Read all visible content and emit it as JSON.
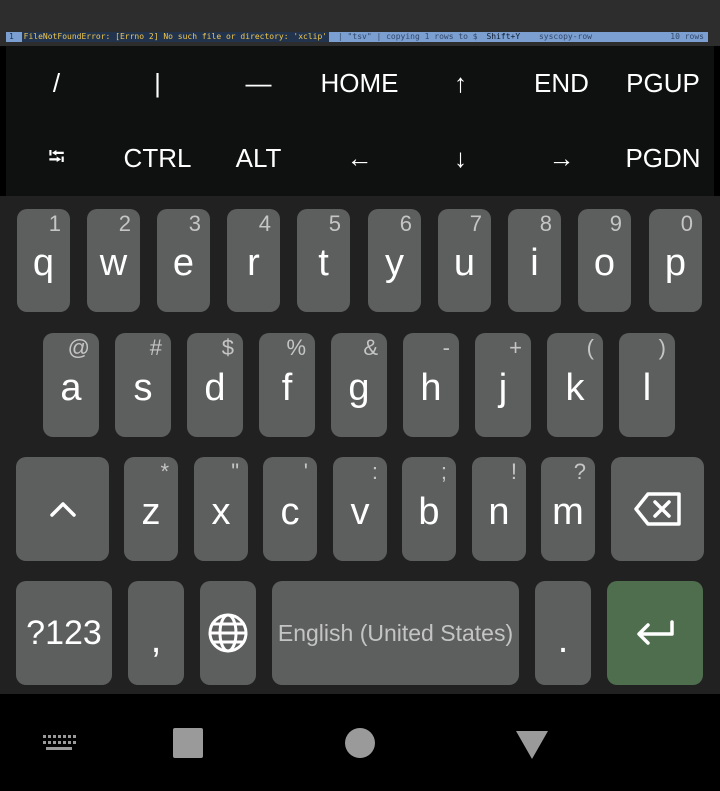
{
  "terminal": {
    "status_left": "1",
    "status_error": "FileNotFoundError: [Errno 2] No such file or directory: 'xclip'",
    "status_hint_pre": "| \"tsv\"  | copying 1 rows to $",
    "status_shortcut": "Shift+Y",
    "status_cmd": "syscopy-row",
    "status_rows": "10 rows"
  },
  "extra_keys": {
    "row1": [
      "/",
      "|",
      "—",
      "HOME",
      "↑",
      "END",
      "PGUP"
    ],
    "row2": [
      "⭾",
      "CTRL",
      "ALT",
      "←",
      "↓",
      "→",
      "PGDN"
    ]
  },
  "keyboard": {
    "row1": [
      {
        "char": "q",
        "hint": "1"
      },
      {
        "char": "w",
        "hint": "2"
      },
      {
        "char": "e",
        "hint": "3"
      },
      {
        "char": "r",
        "hint": "4"
      },
      {
        "char": "t",
        "hint": "5"
      },
      {
        "char": "y",
        "hint": "6"
      },
      {
        "char": "u",
        "hint": "7"
      },
      {
        "char": "i",
        "hint": "8"
      },
      {
        "char": "o",
        "hint": "9"
      },
      {
        "char": "p",
        "hint": "0"
      }
    ],
    "row2": [
      {
        "char": "a",
        "hint": "@"
      },
      {
        "char": "s",
        "hint": "#"
      },
      {
        "char": "d",
        "hint": "$"
      },
      {
        "char": "f",
        "hint": "%"
      },
      {
        "char": "g",
        "hint": "&"
      },
      {
        "char": "h",
        "hint": "-"
      },
      {
        "char": "j",
        "hint": "+"
      },
      {
        "char": "k",
        "hint": "("
      },
      {
        "char": "l",
        "hint": ")"
      }
    ],
    "row3": [
      {
        "char": "z",
        "hint": "*"
      },
      {
        "char": "x",
        "hint": "\""
      },
      {
        "char": "c",
        "hint": "'"
      },
      {
        "char": "v",
        "hint": ":"
      },
      {
        "char": "b",
        "hint": ";"
      },
      {
        "char": "n",
        "hint": "!"
      },
      {
        "char": "m",
        "hint": "?"
      }
    ],
    "symbols_label": "?123",
    "comma_label": ",",
    "space_label": "English (United States)",
    "period_label": ".",
    "icons": {
      "shift": "shift-icon",
      "backspace": "backspace-icon",
      "globe": "globe-icon",
      "enter": "enter-icon"
    },
    "colors": {
      "key": "#5d5e5e",
      "enter": "#4f6e4e",
      "background": "#202120"
    }
  },
  "navbar": {
    "icons": [
      "keyboard-icon",
      "recents-icon",
      "home-icon",
      "back-icon"
    ]
  }
}
